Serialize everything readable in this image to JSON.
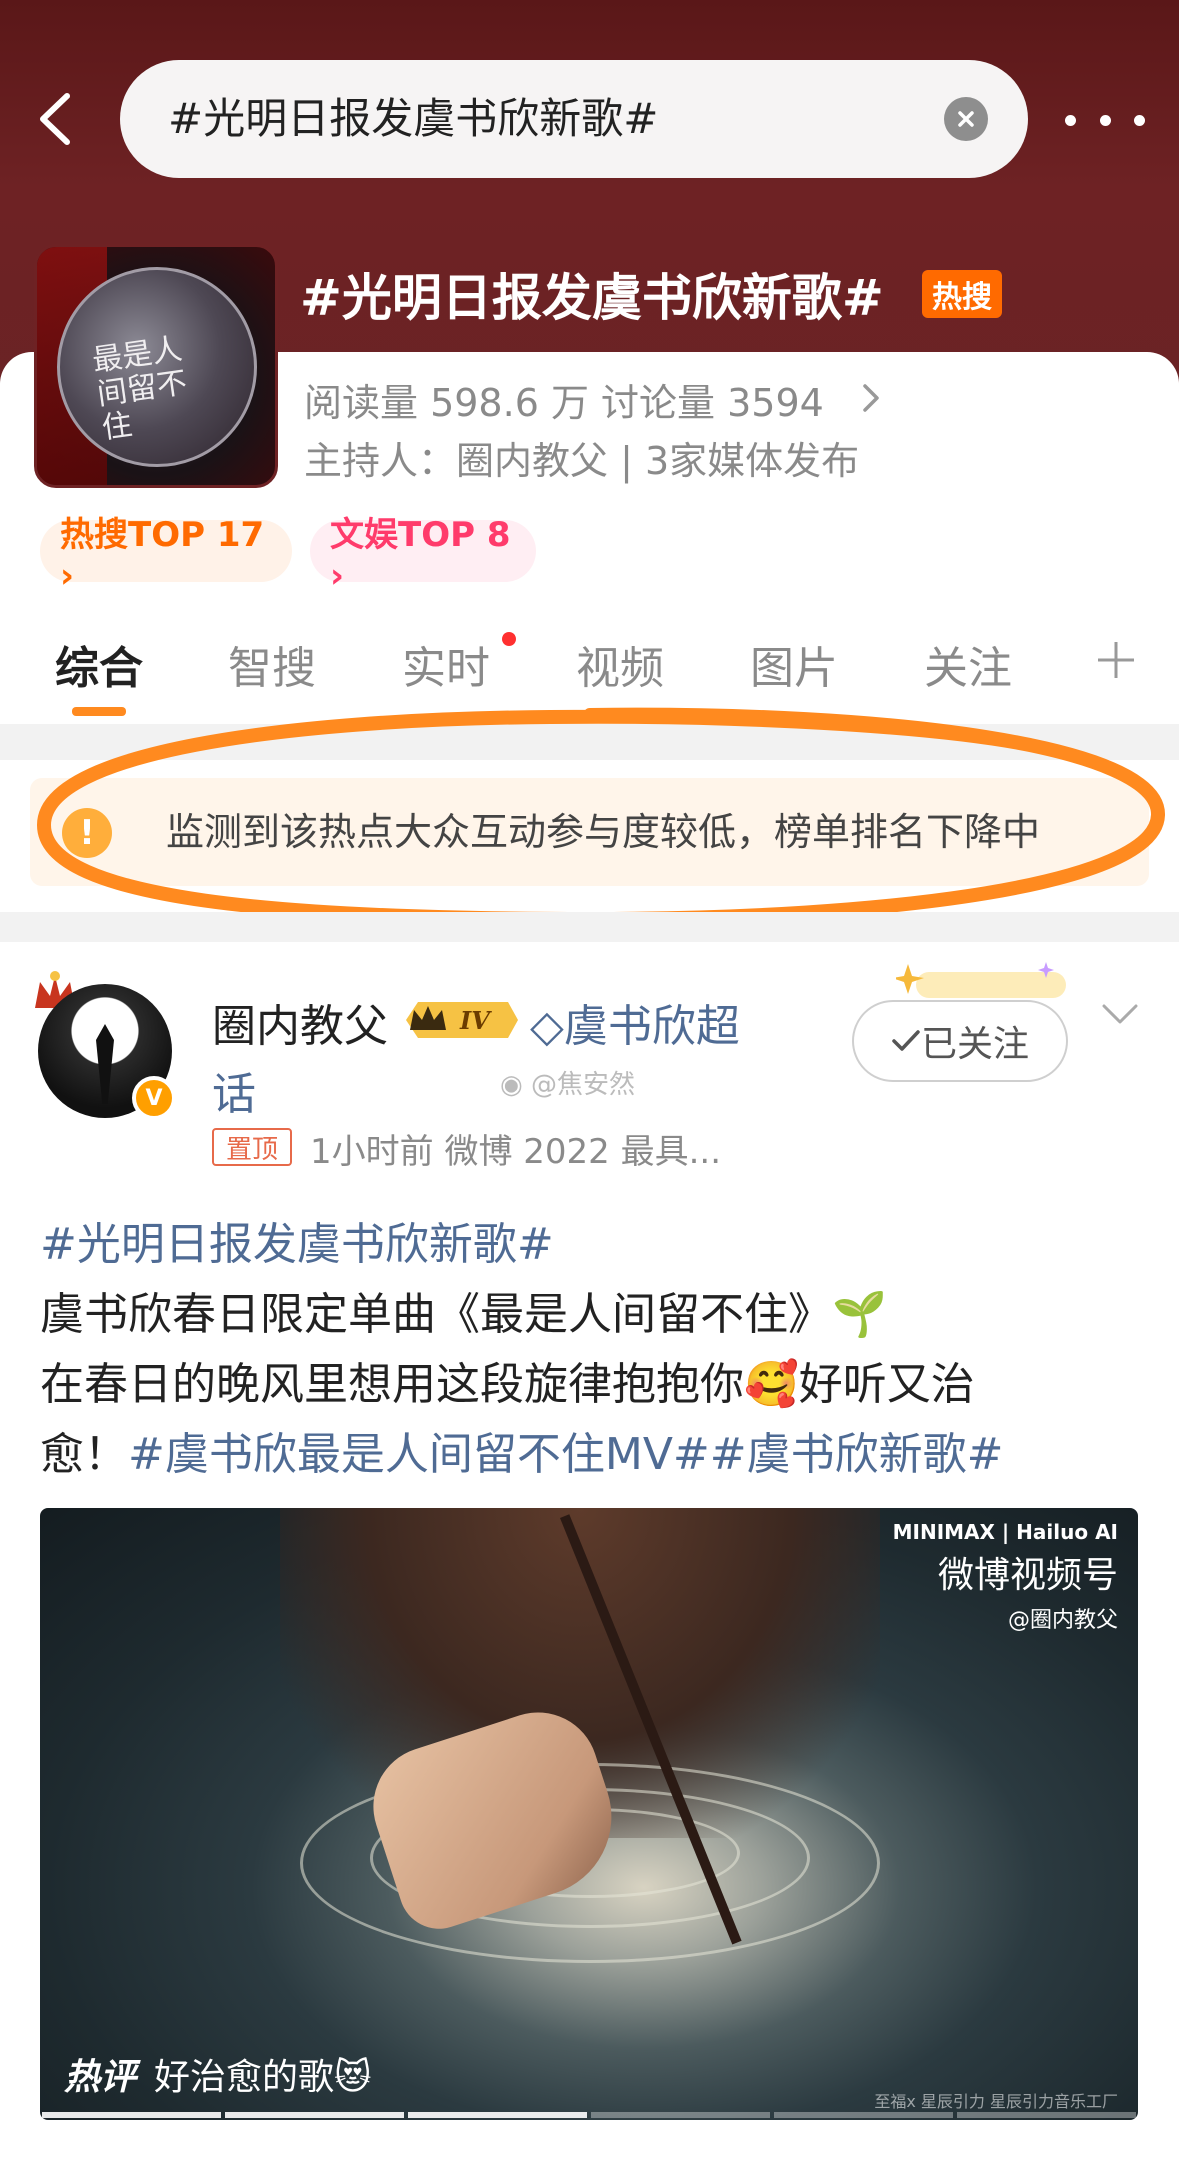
{
  "search": {
    "query": "#光明日报发虞书欣新歌#"
  },
  "topic": {
    "title": "#光明日报发虞书欣新歌#",
    "hot_badge": "热搜",
    "stats": "阅读量 598.6 万  讨论量 3594",
    "host": "主持人：圈内教父 | 3家媒体发布",
    "cover_text": "最是人间留不住",
    "ranks": [
      {
        "label": "热搜TOP 17 ›",
        "color": "#ff6a00"
      },
      {
        "label": "文娱TOP 8 ›",
        "color": "#ff3b6b"
      }
    ]
  },
  "tabs": [
    {
      "label": "综合"
    },
    {
      "label": "智搜"
    },
    {
      "label": "实时"
    },
    {
      "label": "视频"
    },
    {
      "label": "图片"
    },
    {
      "label": "关注"
    }
  ],
  "notice": {
    "icon": "!",
    "text": "监测到该热点大众互动参与度较低，榜单排名下降中"
  },
  "post": {
    "username": "圈内教父",
    "level_badge": "IV",
    "super_topic": "虞书欣超",
    "super_topic_cont": "话",
    "watermark": "@焦安然",
    "follow_label": "已关注",
    "pin_label": "置顶",
    "meta": "1小时前  微博 2022 最具...",
    "body": {
      "hashtag1": "#光明日报发虞书欣新歌#",
      "line2": "虞书欣春日限定单曲《最是人间留不住》🌱",
      "line3": "在春日的晚风里想用这段旋律抱抱你🥰好听又治",
      "line4_prefix": "愈！",
      "hashtag2": "#虞书欣最是人间留不住MV#",
      "hashtag3": "#虞书欣新歌#"
    },
    "video": {
      "brand_top": "MINIMAX | Hailuo AI",
      "brand_main": "微博视频号",
      "brand_sub": "@圈内教父",
      "hot_tag": "热评",
      "hot_comment": "好治愈的歌😻",
      "credits": "至福x 星辰引力  星辰引力音乐工厂"
    }
  },
  "colors": {
    "header_bg": "#6e2224",
    "accent_orange": "#ff8a1f",
    "hashtag_blue": "#4f6b94",
    "annotation_orange": "#ff8a1f"
  }
}
